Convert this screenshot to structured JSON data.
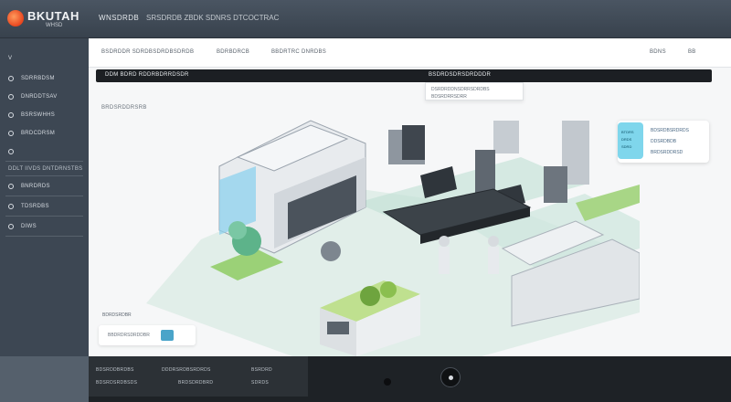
{
  "app": {
    "logo_text": "BKUTAH",
    "logo_sub": "WHSD",
    "title": "WNSDRDB",
    "subtitle": "SRSDRDB ZBDK SDNRS DTCOCTRAC"
  },
  "sidebar": {
    "items": [
      {
        "label": "V"
      },
      {
        "label": "SDRRBDSM"
      },
      {
        "label": "DNRDDTSAV"
      },
      {
        "label": "BSRSWHHS"
      },
      {
        "label": "BRDCDRSM"
      },
      {
        "label": ""
      }
    ],
    "section_title": "DDLT IIVDS DNTDRNSTBS",
    "section_items": [
      {
        "label": "BNRDRDS"
      },
      {
        "label": "TDSRDBS"
      },
      {
        "label": "DIWS"
      }
    ]
  },
  "toolbar": {
    "left_text": "BSDRDDR SDRDBSDRDBSDRDB",
    "mid_text": "BDRBDRCB",
    "right_text": "BBDRTRC DNRDBS",
    "far_right": "BDNS",
    "far_right2": "BB"
  },
  "darkbar": {
    "left": "DDM  BDRD  RDDRBDRRDSDR",
    "right": "BSDRDSDRSDRDDDR"
  },
  "dropdown": {
    "line1": "DSRDRDDNSDRRSDRDBS",
    "line2": "BDSRDRRSDRR"
  },
  "section_label": "BRDSRDDRSRB",
  "info_card": {
    "tag_lines": [
      "BTDRS",
      "DRDS",
      "SDRD"
    ],
    "rows": [
      "BDSRDBSRDRDS",
      "DDSRDBDB",
      "BRDSRDDRSD"
    ]
  },
  "bottom": {
    "label": "BDRDSRDBR",
    "panel_text": "BBDRDRSDRDDBR"
  },
  "footer": {
    "links": [
      "BDSRDDBRDBS",
      "DDDRSRDBSRDRDS",
      "BSRDRD",
      "BDSRDSRDBSDS",
      "BRDSDRDBRD",
      "SDRDS"
    ]
  },
  "colors": {
    "accent": "#4aa4c9",
    "logo": "#e8451e",
    "sidebar": "#3d4753",
    "topbar": "#38424d"
  }
}
